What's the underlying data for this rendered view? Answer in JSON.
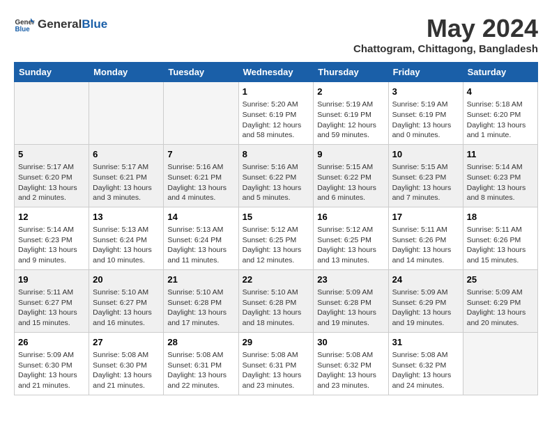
{
  "header": {
    "logo_general": "General",
    "logo_blue": "Blue",
    "month_year": "May 2024",
    "location": "Chattogram, Chittagong, Bangladesh"
  },
  "weekdays": [
    "Sunday",
    "Monday",
    "Tuesday",
    "Wednesday",
    "Thursday",
    "Friday",
    "Saturday"
  ],
  "weeks": [
    [
      {
        "day": "",
        "info": ""
      },
      {
        "day": "",
        "info": ""
      },
      {
        "day": "",
        "info": ""
      },
      {
        "day": "1",
        "info": "Sunrise: 5:20 AM\nSunset: 6:19 PM\nDaylight: 12 hours and 58 minutes."
      },
      {
        "day": "2",
        "info": "Sunrise: 5:19 AM\nSunset: 6:19 PM\nDaylight: 12 hours and 59 minutes."
      },
      {
        "day": "3",
        "info": "Sunrise: 5:19 AM\nSunset: 6:19 PM\nDaylight: 13 hours and 0 minutes."
      },
      {
        "day": "4",
        "info": "Sunrise: 5:18 AM\nSunset: 6:20 PM\nDaylight: 13 hours and 1 minute."
      }
    ],
    [
      {
        "day": "5",
        "info": "Sunrise: 5:17 AM\nSunset: 6:20 PM\nDaylight: 13 hours and 2 minutes."
      },
      {
        "day": "6",
        "info": "Sunrise: 5:17 AM\nSunset: 6:21 PM\nDaylight: 13 hours and 3 minutes."
      },
      {
        "day": "7",
        "info": "Sunrise: 5:16 AM\nSunset: 6:21 PM\nDaylight: 13 hours and 4 minutes."
      },
      {
        "day": "8",
        "info": "Sunrise: 5:16 AM\nSunset: 6:22 PM\nDaylight: 13 hours and 5 minutes."
      },
      {
        "day": "9",
        "info": "Sunrise: 5:15 AM\nSunset: 6:22 PM\nDaylight: 13 hours and 6 minutes."
      },
      {
        "day": "10",
        "info": "Sunrise: 5:15 AM\nSunset: 6:23 PM\nDaylight: 13 hours and 7 minutes."
      },
      {
        "day": "11",
        "info": "Sunrise: 5:14 AM\nSunset: 6:23 PM\nDaylight: 13 hours and 8 minutes."
      }
    ],
    [
      {
        "day": "12",
        "info": "Sunrise: 5:14 AM\nSunset: 6:23 PM\nDaylight: 13 hours and 9 minutes."
      },
      {
        "day": "13",
        "info": "Sunrise: 5:13 AM\nSunset: 6:24 PM\nDaylight: 13 hours and 10 minutes."
      },
      {
        "day": "14",
        "info": "Sunrise: 5:13 AM\nSunset: 6:24 PM\nDaylight: 13 hours and 11 minutes."
      },
      {
        "day": "15",
        "info": "Sunrise: 5:12 AM\nSunset: 6:25 PM\nDaylight: 13 hours and 12 minutes."
      },
      {
        "day": "16",
        "info": "Sunrise: 5:12 AM\nSunset: 6:25 PM\nDaylight: 13 hours and 13 minutes."
      },
      {
        "day": "17",
        "info": "Sunrise: 5:11 AM\nSunset: 6:26 PM\nDaylight: 13 hours and 14 minutes."
      },
      {
        "day": "18",
        "info": "Sunrise: 5:11 AM\nSunset: 6:26 PM\nDaylight: 13 hours and 15 minutes."
      }
    ],
    [
      {
        "day": "19",
        "info": "Sunrise: 5:11 AM\nSunset: 6:27 PM\nDaylight: 13 hours and 15 minutes."
      },
      {
        "day": "20",
        "info": "Sunrise: 5:10 AM\nSunset: 6:27 PM\nDaylight: 13 hours and 16 minutes."
      },
      {
        "day": "21",
        "info": "Sunrise: 5:10 AM\nSunset: 6:28 PM\nDaylight: 13 hours and 17 minutes."
      },
      {
        "day": "22",
        "info": "Sunrise: 5:10 AM\nSunset: 6:28 PM\nDaylight: 13 hours and 18 minutes."
      },
      {
        "day": "23",
        "info": "Sunrise: 5:09 AM\nSunset: 6:28 PM\nDaylight: 13 hours and 19 minutes."
      },
      {
        "day": "24",
        "info": "Sunrise: 5:09 AM\nSunset: 6:29 PM\nDaylight: 13 hours and 19 minutes."
      },
      {
        "day": "25",
        "info": "Sunrise: 5:09 AM\nSunset: 6:29 PM\nDaylight: 13 hours and 20 minutes."
      }
    ],
    [
      {
        "day": "26",
        "info": "Sunrise: 5:09 AM\nSunset: 6:30 PM\nDaylight: 13 hours and 21 minutes."
      },
      {
        "day": "27",
        "info": "Sunrise: 5:08 AM\nSunset: 6:30 PM\nDaylight: 13 hours and 21 minutes."
      },
      {
        "day": "28",
        "info": "Sunrise: 5:08 AM\nSunset: 6:31 PM\nDaylight: 13 hours and 22 minutes."
      },
      {
        "day": "29",
        "info": "Sunrise: 5:08 AM\nSunset: 6:31 PM\nDaylight: 13 hours and 23 minutes."
      },
      {
        "day": "30",
        "info": "Sunrise: 5:08 AM\nSunset: 6:32 PM\nDaylight: 13 hours and 23 minutes."
      },
      {
        "day": "31",
        "info": "Sunrise: 5:08 AM\nSunset: 6:32 PM\nDaylight: 13 hours and 24 minutes."
      },
      {
        "day": "",
        "info": ""
      }
    ]
  ]
}
